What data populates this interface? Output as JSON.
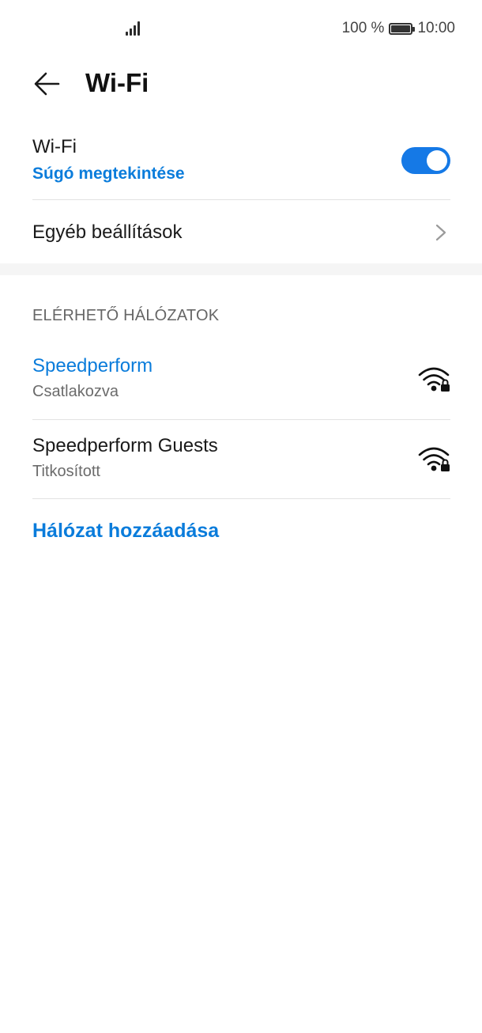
{
  "status_bar": {
    "battery_percent": "100 %",
    "time": "10:00"
  },
  "header": {
    "title": "Wi-Fi"
  },
  "wifi_setting": {
    "title": "Wi-Fi",
    "help_link": "Súgó megtekintése",
    "enabled": true
  },
  "other_settings": {
    "label": "Egyéb beállítások"
  },
  "networks_section": {
    "heading": "ELÉRHETŐ HÁLÓZATOK",
    "networks": [
      {
        "name": "Speedperform",
        "status": "Csatlakozva",
        "connected": true,
        "secured": true
      },
      {
        "name": "Speedperform Guests",
        "status": "Titkosított",
        "connected": false,
        "secured": true
      }
    ],
    "add_network": "Hálózat hozzáadása"
  },
  "colors": {
    "accent": "#0a7cdb",
    "toggle_on": "#1579e6"
  }
}
